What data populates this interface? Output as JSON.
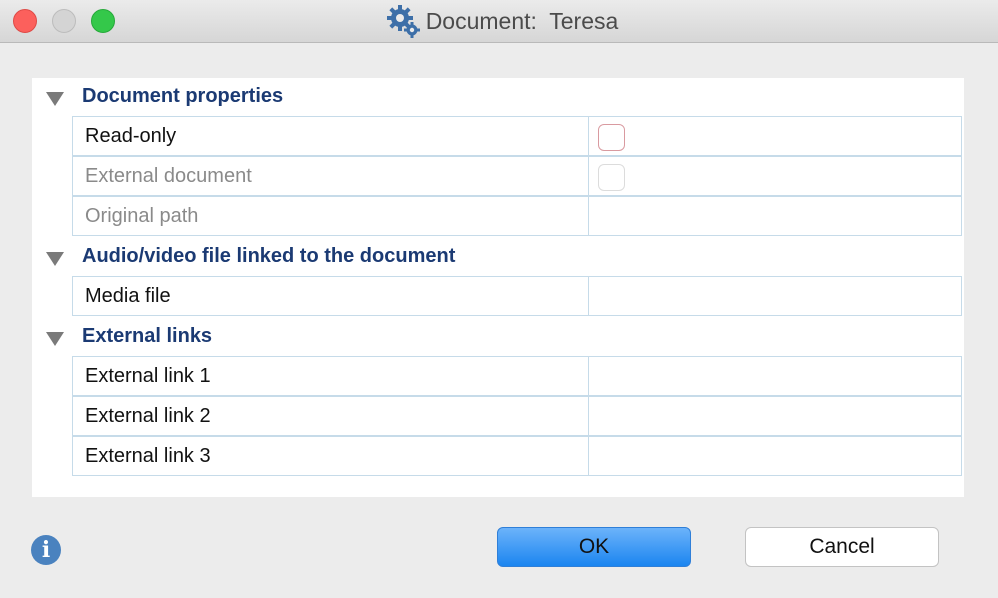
{
  "window": {
    "title": "Document:  Teresa"
  },
  "sections": [
    {
      "label": "Document properties",
      "rows": [
        {
          "label": "Read-only",
          "enabled": true,
          "control": "checkbox",
          "checked": false
        },
        {
          "label": "External document",
          "enabled": false,
          "control": "checkbox",
          "checked": false
        },
        {
          "label": "Original path",
          "enabled": false,
          "control": "text",
          "value": ""
        }
      ]
    },
    {
      "label": "Audio/video file linked to the document",
      "rows": [
        {
          "label": "Media file",
          "enabled": true,
          "control": "text",
          "value": ""
        }
      ]
    },
    {
      "label": "External links",
      "rows": [
        {
          "label": "External link 1",
          "enabled": true,
          "control": "text",
          "value": ""
        },
        {
          "label": "External link 2",
          "enabled": true,
          "control": "text",
          "value": ""
        },
        {
          "label": "External link 3",
          "enabled": true,
          "control": "text",
          "value": ""
        }
      ]
    }
  ],
  "buttons": {
    "ok_label": "OK",
    "cancel_label": "Cancel"
  },
  "icons": {
    "title": "gears-icon",
    "info": "info-icon"
  },
  "colors": {
    "section_header": "#1b3a73",
    "primary_button": "#1b85f0",
    "info_icon": "#4a82bf"
  }
}
